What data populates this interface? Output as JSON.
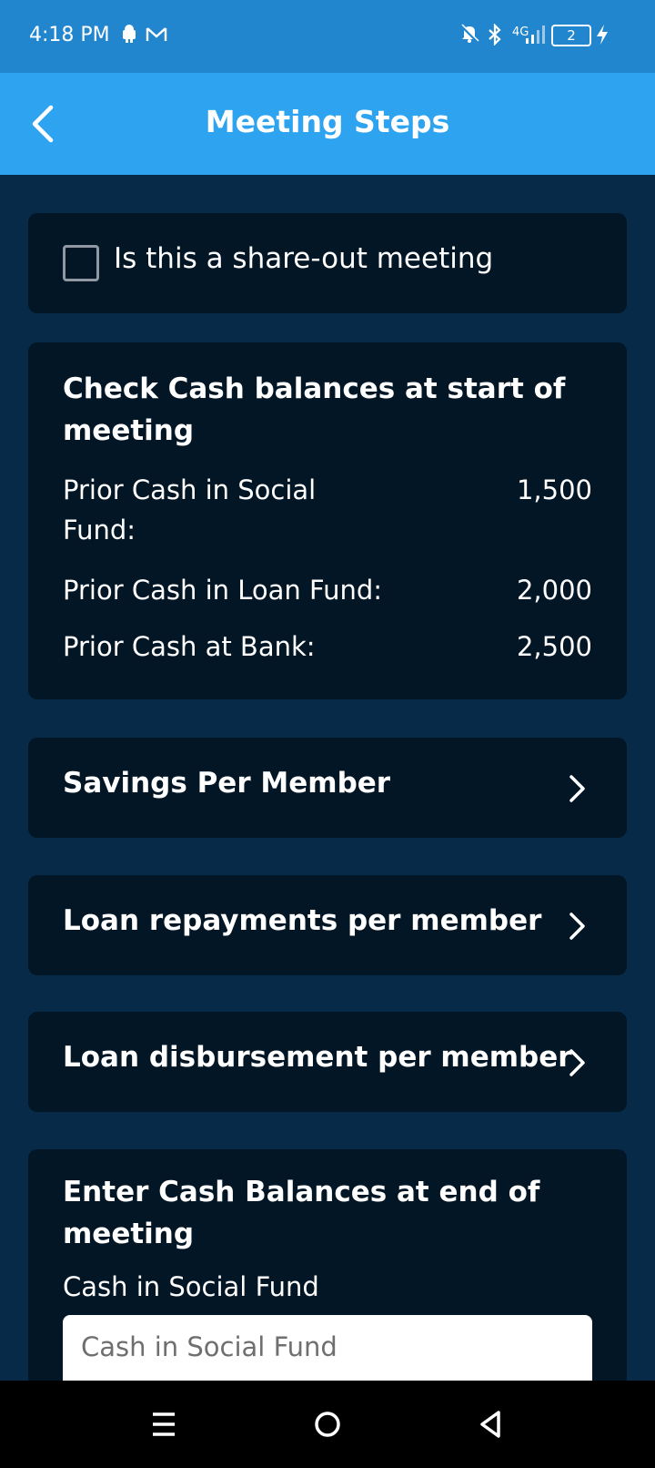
{
  "status_bar": {
    "time": "4:18 PM",
    "network": "4G",
    "battery": "2"
  },
  "app_bar": {
    "title": "Meeting Steps"
  },
  "share_out": {
    "label": "Is this a share-out meeting",
    "checked": false
  },
  "cash_start": {
    "heading": "Check Cash balances at start of meeting",
    "rows": [
      {
        "label": "Prior Cash in Social Fund:",
        "value": "1,500"
      },
      {
        "label": "Prior Cash in Loan Fund:",
        "value": "2,000"
      },
      {
        "label": "Prior Cash at Bank:",
        "value": "2,500"
      }
    ]
  },
  "nav_items": [
    {
      "label": "Savings Per Member"
    },
    {
      "label": "Loan repayments per member"
    },
    {
      "label": "Loan disbursement per member"
    }
  ],
  "cash_end": {
    "heading": "Enter Cash Balances at end of meeting",
    "social_fund_label": "Cash in Social Fund",
    "social_fund_placeholder": "Cash in Social Fund",
    "social_fund_value": ""
  },
  "icons": {
    "back": "back-arrow-icon",
    "chevron": "chevron-right-icon",
    "menu": "menu-icon",
    "home": "home-circle-icon",
    "nav_back": "triangle-back-icon"
  },
  "colors": {
    "status_bar": "#2286cf",
    "app_bar": "#2ea4f0",
    "background": "#062a48",
    "card": "#021625"
  }
}
